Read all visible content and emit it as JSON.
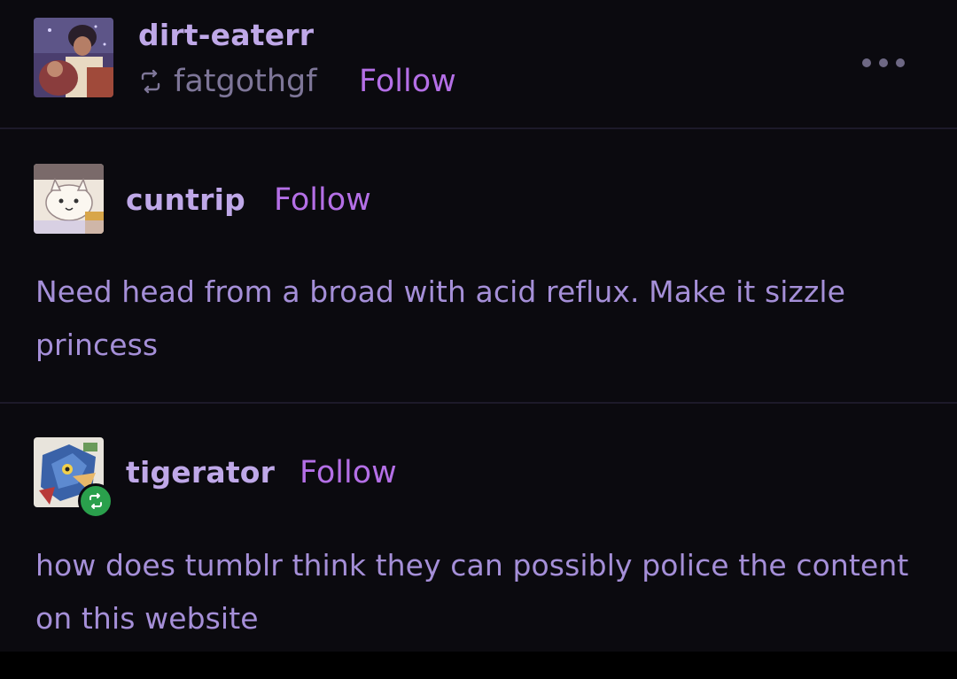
{
  "posts": [
    {
      "username": "dirt-eaterr",
      "reblogged_from": "fatgothgf",
      "follow_label": "Follow"
    },
    {
      "username": "cuntrip",
      "follow_label": "Follow",
      "body": "Need head from a broad with acid reflux. Make it sizzle princess"
    },
    {
      "username": "tigerator",
      "follow_label": "Follow",
      "body": "how does tumblr think they can possibly police the content on this website"
    }
  ],
  "icons": {
    "reblog": "reblog-icon",
    "more": "more-options-icon",
    "reblog_badge": "reblog-badge-icon"
  },
  "colors": {
    "background": "#0b0a0f",
    "username": "#bfa8e8",
    "follow": "#b46fe6",
    "body_text": "#a58fd8",
    "reblog_badge": "#2aa04c"
  }
}
